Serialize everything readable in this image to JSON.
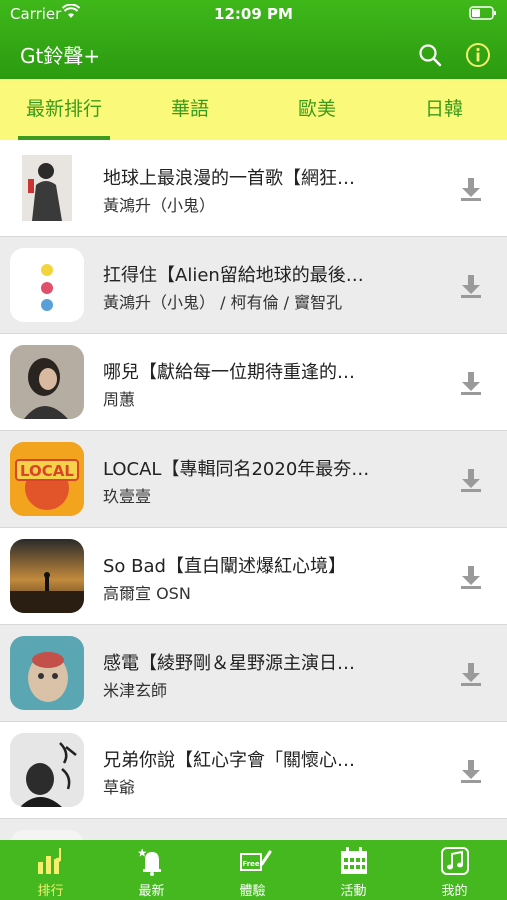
{
  "status_bar": {
    "carrier": "Carrier",
    "time": "12:09 PM"
  },
  "app": {
    "title": "Gt鈴聲+"
  },
  "tabs": [
    {
      "label": "最新排行"
    },
    {
      "label": "華語"
    },
    {
      "label": "歐美"
    },
    {
      "label": "日韓"
    }
  ],
  "songs": [
    {
      "title": "地球上最浪漫的一首歌【網狂…",
      "artist": "黃鴻升（小鬼）"
    },
    {
      "title": "扛得住【Alien留給地球的最後…",
      "artist": "黃鴻升（小鬼） / 柯有倫 / 竇智孔"
    },
    {
      "title": "哪兒【獻給每一位期待重逢的…",
      "artist": "周蕙"
    },
    {
      "title": "LOCAL【專輯同名2020年最夯…",
      "artist": "玖壹壹",
      "cover_text": "LOCAL"
    },
    {
      "title": "So Bad【直白闡述爆紅心境】",
      "artist": "高爾宣 OSN"
    },
    {
      "title": "感電【綾野剛＆星野源主演日…",
      "artist": "米津玄師"
    },
    {
      "title": "兄弟你說【紅心字會「關懷心…",
      "artist": "草爺"
    }
  ],
  "bottom_tabs": [
    {
      "label": "排行",
      "icon": "chart-icon"
    },
    {
      "label": "最新",
      "icon": "bell-icon"
    },
    {
      "label": "體驗",
      "icon": "free-icon",
      "badge": "Free"
    },
    {
      "label": "活動",
      "icon": "calendar-icon"
    },
    {
      "label": "我的",
      "icon": "music-icon"
    }
  ],
  "colors": {
    "header": "#2b9a10",
    "tab_bar": "#fbf97a",
    "tab_text": "#3c9a1c",
    "bottom_bar": "#45b81f",
    "active_bottom": "#f5ef6b"
  }
}
